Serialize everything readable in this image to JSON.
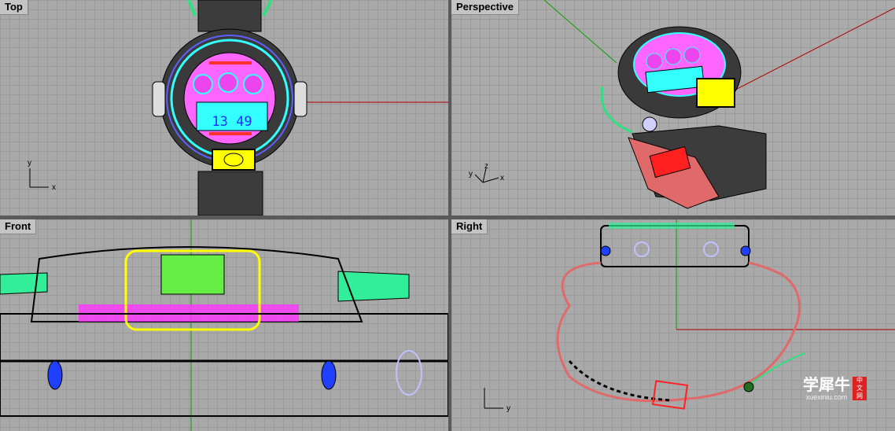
{
  "viewports": {
    "top": {
      "title": "Top",
      "axis_x": "x",
      "axis_y": "y"
    },
    "perspective": {
      "title": "Perspective",
      "axis_x": "x",
      "axis_y": "y",
      "axis_z": "z"
    },
    "front": {
      "title": "Front"
    },
    "right": {
      "title": "Right",
      "axis_y": "y"
    }
  },
  "watch": {
    "display_time": "13 49"
  },
  "watermark": {
    "brand": "学犀牛",
    "url": "xuexiniu.com",
    "seal": [
      "中",
      "文",
      "网"
    ]
  },
  "colors": {
    "grid_bg": "#a9a9a9",
    "grid_line": "#9b9b9b",
    "axis_x": "#b00000",
    "axis_y": "#00a000",
    "magenta": "#ff33ff",
    "cyan": "#33ffff",
    "yellow": "#ffff00",
    "red": "#ff2020"
  },
  "icons": {
    "axis_gizmo": "axis-icon"
  }
}
